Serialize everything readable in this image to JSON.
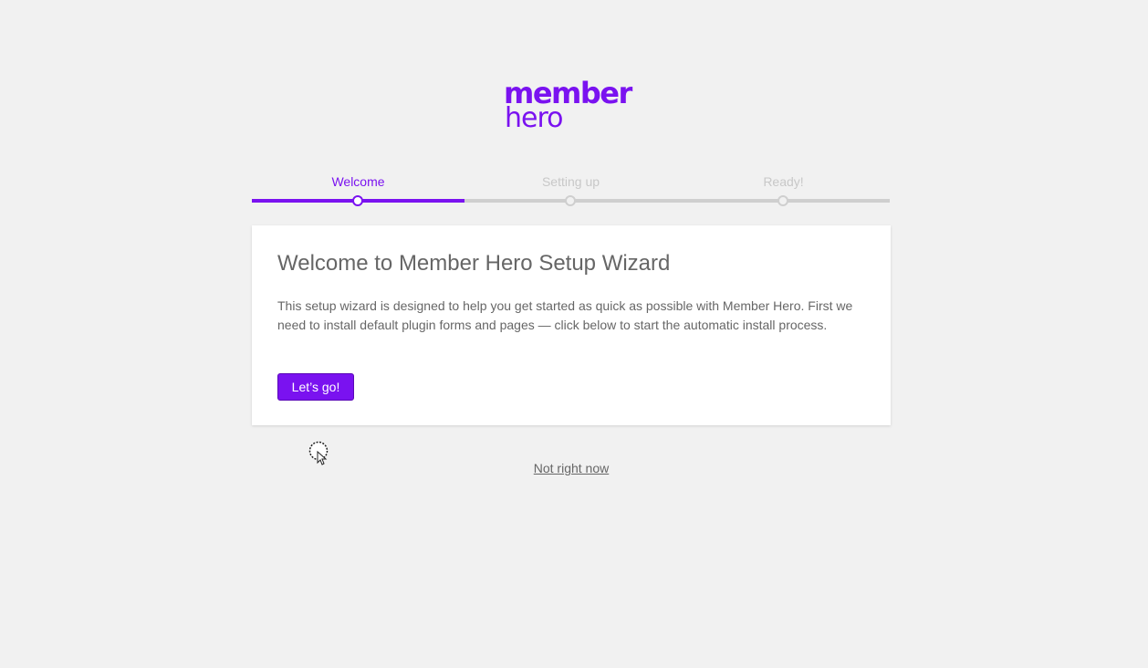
{
  "logo": {
    "line1": "member",
    "line2": "hero"
  },
  "steps": [
    {
      "label": "Welcome",
      "state": "active"
    },
    {
      "label": "Setting up",
      "state": "pending"
    },
    {
      "label": "Ready!",
      "state": "pending"
    }
  ],
  "card": {
    "title": "Welcome to Member Hero Setup Wizard",
    "text": "This setup wizard is designed to help you get started as quick as possible with Member Hero. First we need to install default plugin forms and pages — click below to start the automatic install process.",
    "button_label": "Let’s go!"
  },
  "skip_link": "Not right now",
  "colors": {
    "accent": "#7a12f0",
    "background": "#f1f1f1",
    "inactive": "#cfcfcf",
    "text": "#666666"
  },
  "icons": {
    "cursor": "loading-cursor-icon"
  }
}
